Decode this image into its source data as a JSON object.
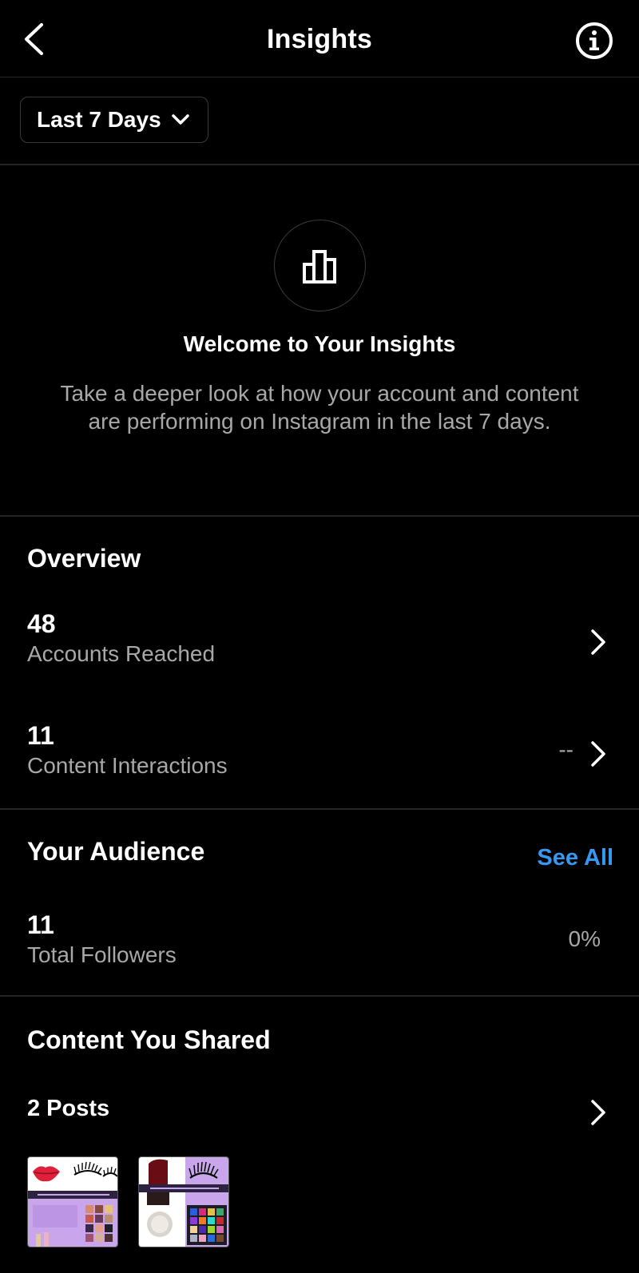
{
  "header": {
    "title": "Insights",
    "back_icon": "chevron-left-icon",
    "info_icon": "info-circle-icon"
  },
  "filter": {
    "range_label": "Last 7 Days",
    "range_icon": "chevron-down-icon"
  },
  "welcome": {
    "icon": "bar-chart-icon",
    "title": "Welcome to Your Insights",
    "description": "Take a deeper look at how your account and content are performing on Instagram in the last 7 days."
  },
  "overview": {
    "title": "Overview",
    "metrics": [
      {
        "value": "48",
        "label": "Accounts Reached",
        "change": ""
      },
      {
        "value": "11",
        "label": "Content Interactions",
        "change": "--"
      }
    ]
  },
  "audience": {
    "title": "Your Audience",
    "see_all": "See All",
    "metrics": [
      {
        "value": "11",
        "label": "Total Followers",
        "change": "0%"
      }
    ]
  },
  "content": {
    "title": "Content You Shared",
    "posts_label": "2 Posts",
    "thumbnails": [
      {
        "caption_top": "COLORFUL PEACOCKS COSMETICS",
        "caption_main": "ONTI S-CODA I NOI",
        "accent": "#b48be0"
      },
      {
        "caption_top": "COLORFUL PEACOCKS COSMETICS",
        "caption_main": "A STAGIONE ELL CCOPPIAMENT",
        "accent": "#b48be0"
      }
    ]
  },
  "colors": {
    "background": "#000000",
    "link": "#3897f0",
    "secondary_text": "#a8a8a8",
    "divider": "#262626"
  }
}
